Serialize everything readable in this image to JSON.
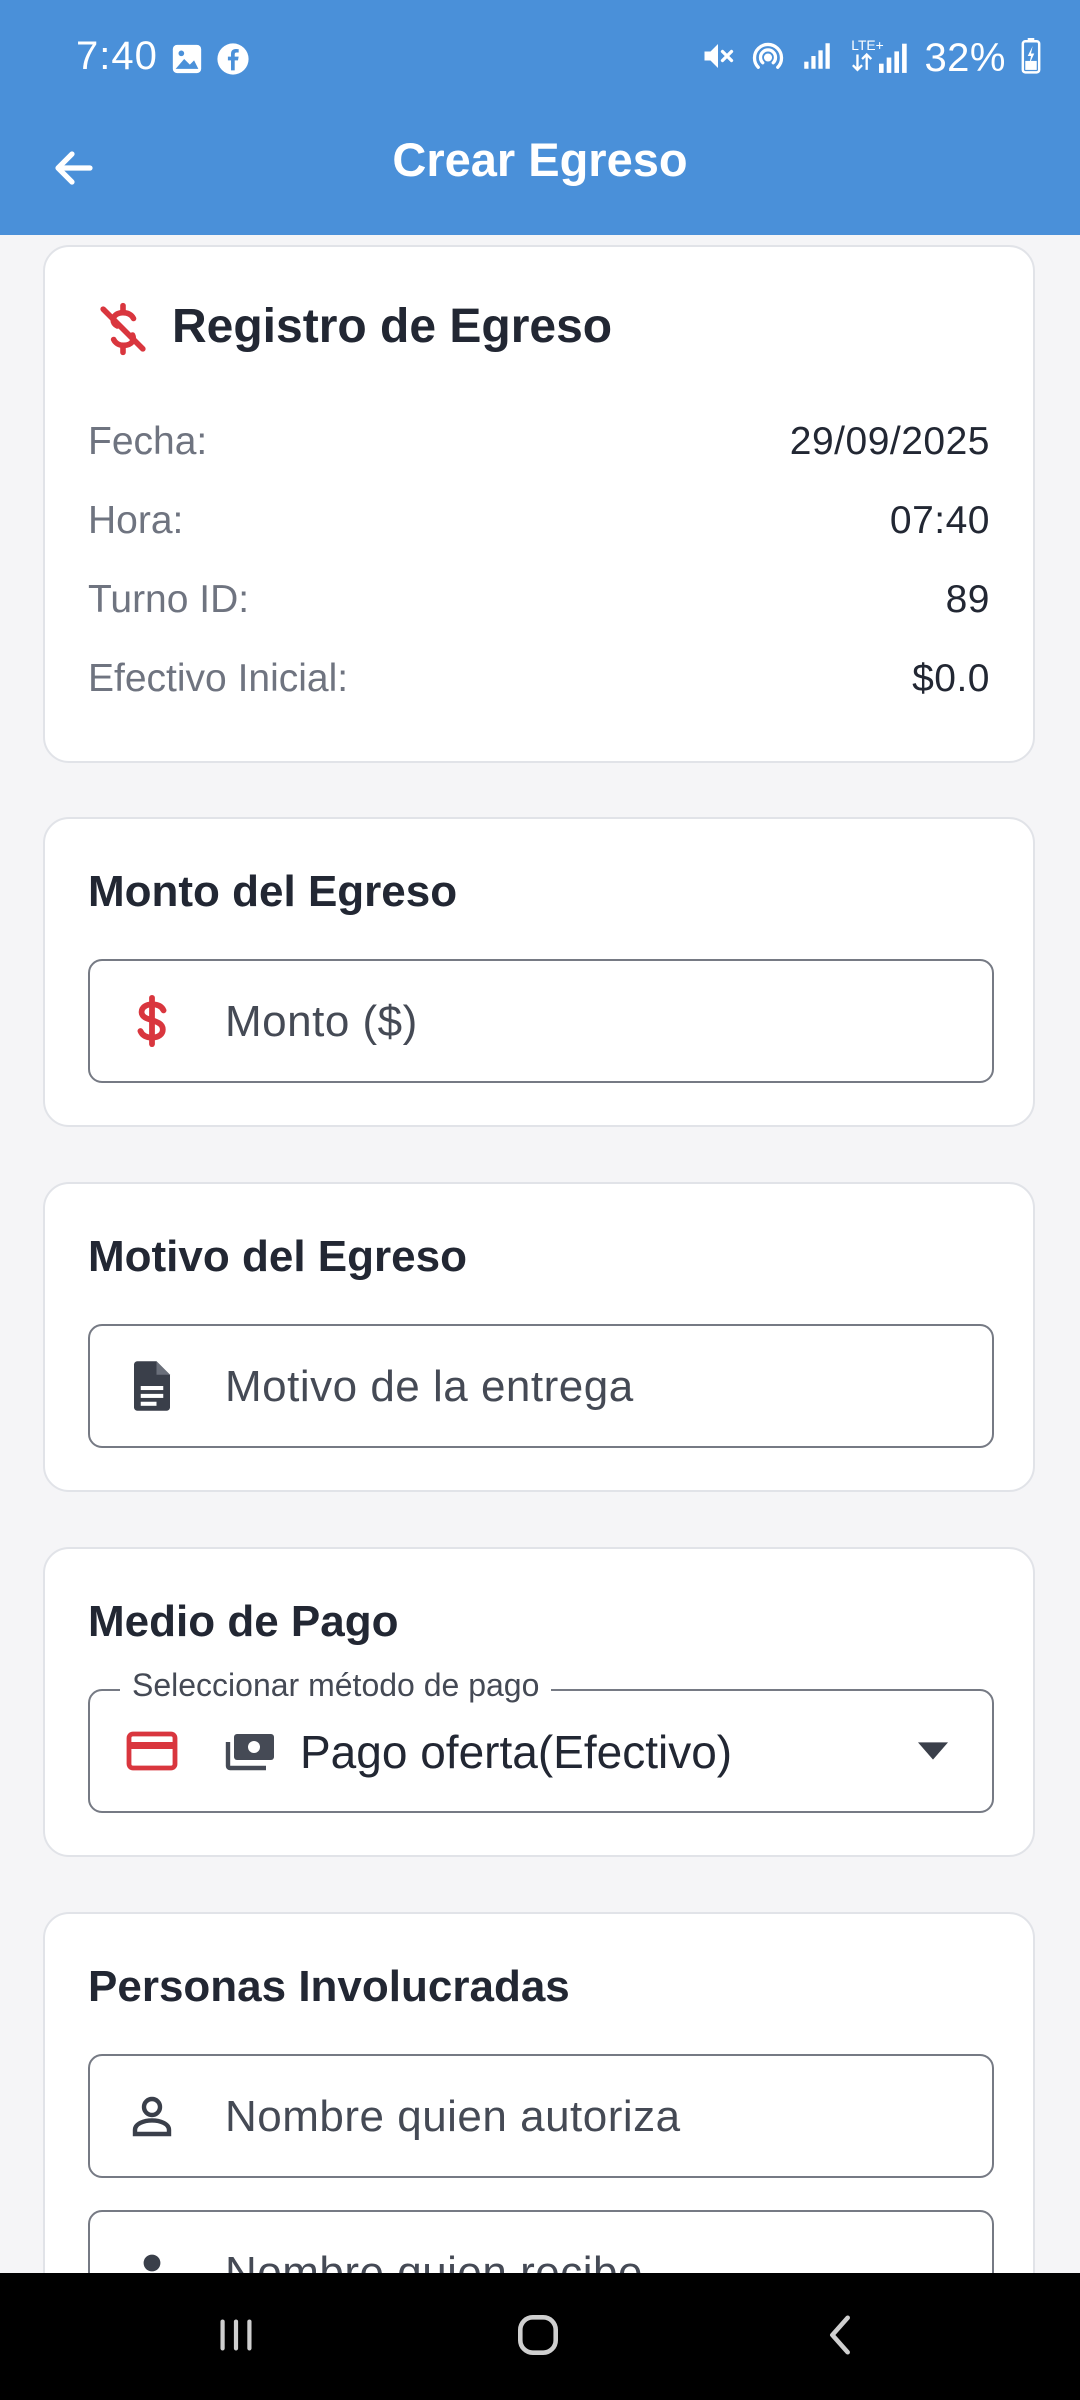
{
  "status_bar": {
    "time": "7:40",
    "battery": "32%",
    "left_icons": [
      "gallery-icon",
      "facebook-icon"
    ],
    "right_icons": [
      "mute-icon",
      "hotspot-icon",
      "signal-icon",
      "lte-signal-icon",
      "battery-icon"
    ]
  },
  "app_bar": {
    "title": "Crear Egreso",
    "back_icon": "arrow-left-icon"
  },
  "summary_card": {
    "title": "Registro de Egreso",
    "icon": "money-off-icon",
    "rows": [
      {
        "label": "Fecha:",
        "value": "29/09/2025"
      },
      {
        "label": "Hora:",
        "value": "07:40"
      },
      {
        "label": "Turno ID:",
        "value": "89"
      },
      {
        "label": "Efectivo Inicial:",
        "value": "$0.0"
      }
    ]
  },
  "amount_card": {
    "title": "Monto del Egreso",
    "placeholder": "Monto ($)",
    "icon": "dollar-icon"
  },
  "reason_card": {
    "title": "Motivo del Egreso",
    "placeholder": "Motivo de la entrega",
    "icon": "document-icon"
  },
  "payment_card": {
    "title": "Medio de Pago",
    "label": "Seleccionar método de pago",
    "selected": "Pago oferta(Efectivo)",
    "icons": [
      "credit-card-icon",
      "cash-icon",
      "dropdown-arrow-icon"
    ]
  },
  "people_card": {
    "title": "Personas Involucradas",
    "authorizer_placeholder": "Nombre quien autoriza",
    "receiver_placeholder": "Nombre quien recibe",
    "icon": "person-icon"
  },
  "colors": {
    "app_bar": "#4a90d9",
    "accent_red": "#d9363e",
    "background": "#f5f5f7",
    "card": "#ffffff",
    "text_dark": "#222733",
    "text_muted": "#6f7480"
  }
}
